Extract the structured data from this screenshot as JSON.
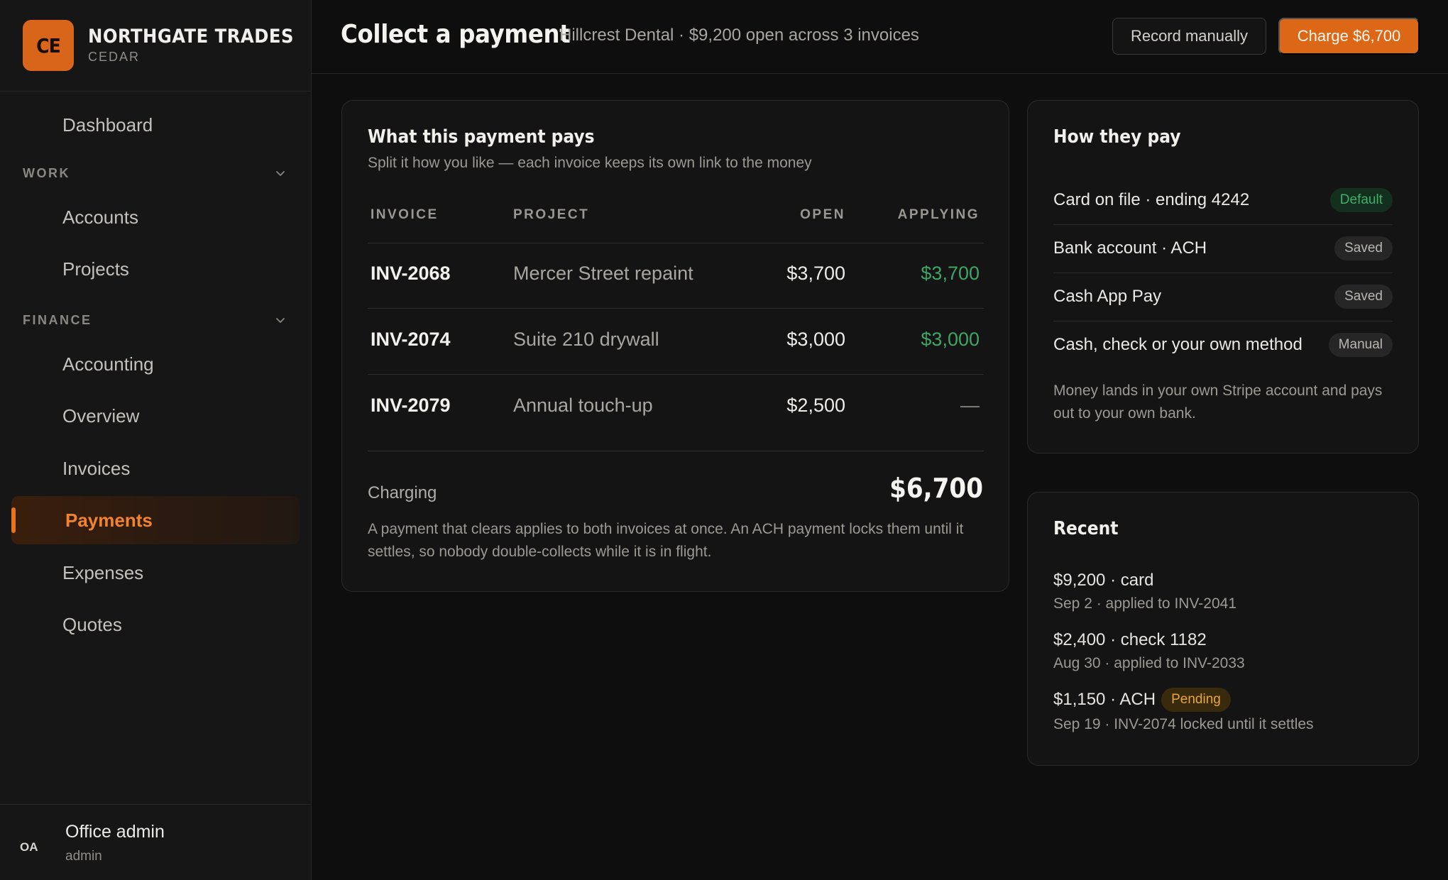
{
  "brand": {
    "logo": "CE",
    "name": "NORTHGATE TRADES",
    "sub": "CEDAR"
  },
  "nav": {
    "dashboard": "Dashboard",
    "work_section": "WORK",
    "accounts": "Accounts",
    "projects": "Projects",
    "finance_section": "FINANCE",
    "accounting": "Accounting",
    "overview": "Overview",
    "invoices": "Invoices",
    "payments": "Payments",
    "expenses": "Expenses",
    "quotes": "Quotes"
  },
  "user": {
    "initials": "OA",
    "name": "Office admin",
    "role": "admin"
  },
  "header": {
    "title": "Collect a payment",
    "subtitle": "Hillcrest Dental · $9,200 open across 3 invoices",
    "record_label": "Record manually",
    "charge_label": "Charge $6,700"
  },
  "payment": {
    "title": "What this payment pays",
    "subtitle": "Split it how you like — each invoice keeps its own link to the money",
    "columns": [
      "INVOICE",
      "PROJECT",
      "OPEN",
      "APPLYING"
    ],
    "rows": [
      {
        "invoice": "INV-2068",
        "project": "Mercer Street repaint",
        "open": "$3,700",
        "applying": "$3,700"
      },
      {
        "invoice": "INV-2074",
        "project": "Suite 210 drywall",
        "open": "$3,000",
        "applying": "$3,000"
      },
      {
        "invoice": "INV-2079",
        "project": "Annual touch-up",
        "open": "$2,500",
        "applying": "—"
      }
    ],
    "charging_label": "Charging",
    "charging_amount": "$6,700",
    "note": "A payment that clears applies to both invoices at once. An ACH payment locks them until it settles, so nobody double-collects while it is in flight."
  },
  "how": {
    "title": "How they pay",
    "methods": [
      {
        "label": "Card on file · ending 4242",
        "badge": "Default"
      },
      {
        "label": "Bank account · ACH",
        "badge": "Saved"
      },
      {
        "label": "Cash App Pay",
        "badge": "Saved"
      },
      {
        "label": "Cash, check or your own method",
        "badge": "Manual"
      }
    ],
    "note": "Money lands in your own Stripe account and pays out to your own bank."
  },
  "recent": {
    "title": "Recent",
    "items": [
      {
        "main": "$9,200 · card",
        "sub": "Sep 2 · applied to INV-2041"
      },
      {
        "main": "$2,400 · check 1182",
        "sub": "Aug 30 · applied to INV-2033"
      },
      {
        "main": "$1,150 · ACH",
        "badge": "Pending",
        "sub": "Sep 19 · INV-2074 locked until it settles"
      }
    ]
  },
  "colors": {
    "accent": "#dc6716",
    "positive": "#3fa564",
    "pending": "#e7a53a",
    "background": "#0e0e0e"
  }
}
